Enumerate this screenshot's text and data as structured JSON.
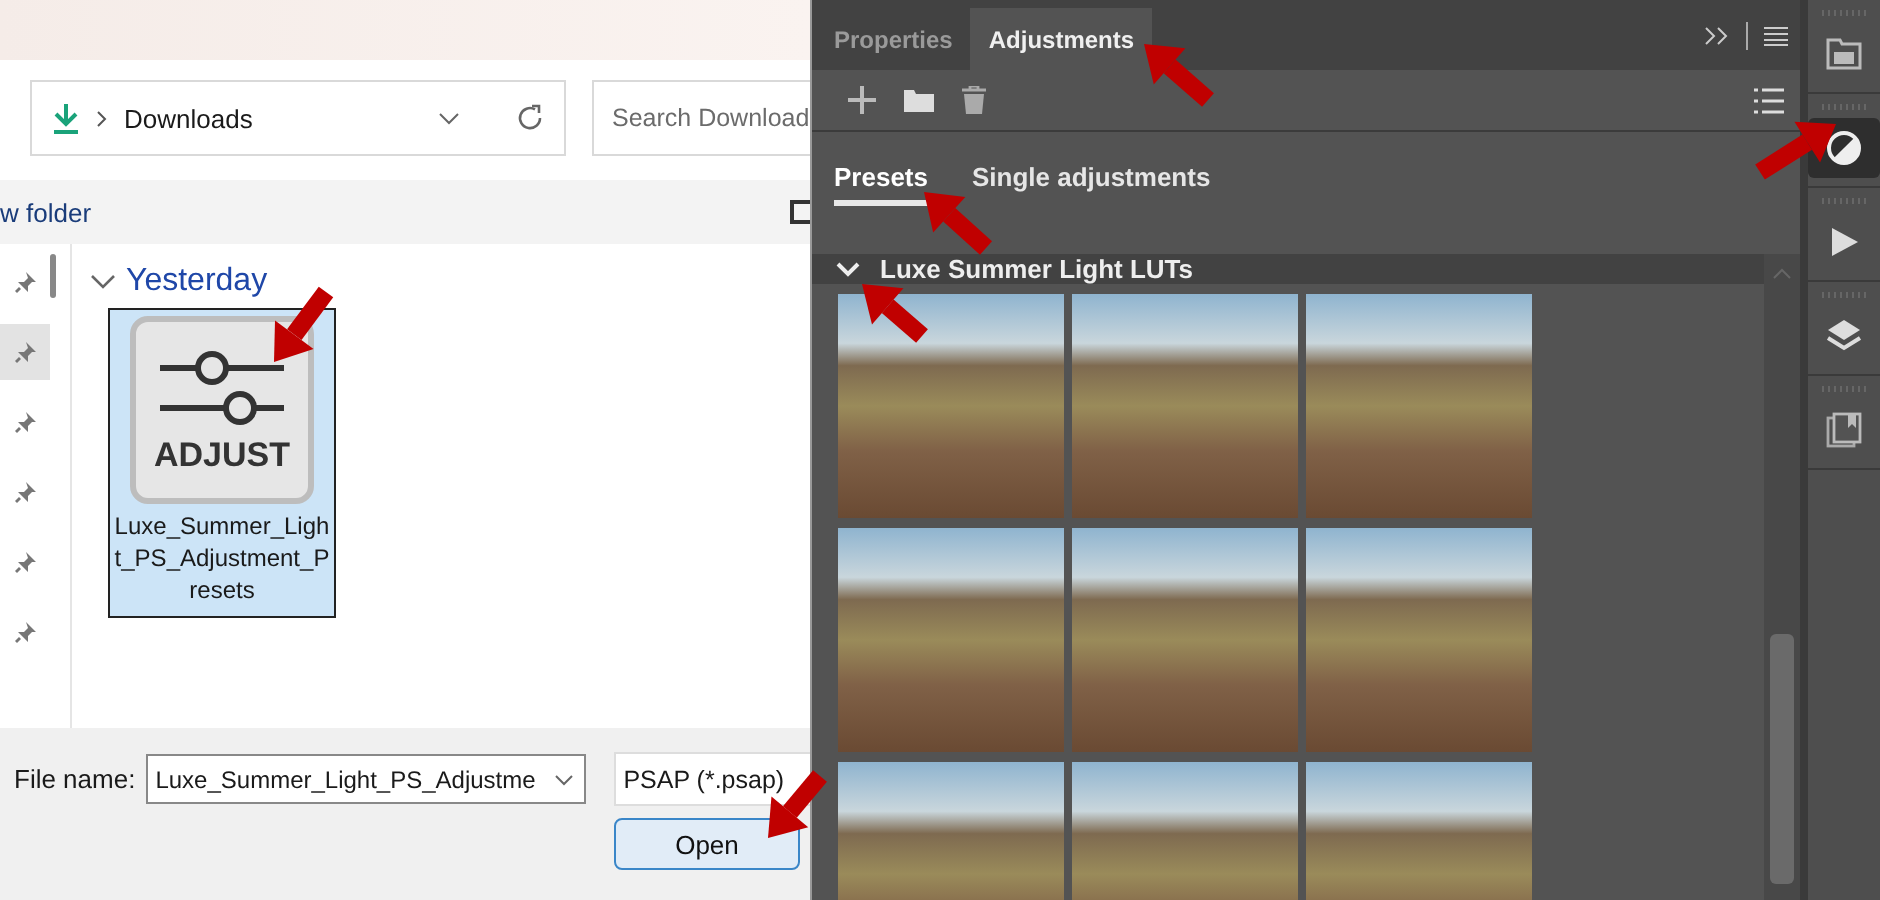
{
  "file_dialog": {
    "breadcrumb": "Downloads",
    "search": {
      "placeholder": "Search Download"
    },
    "toolbar": {
      "new_folder": "w folder"
    },
    "quick_access": [
      {
        "selected": false
      },
      {
        "selected": true
      },
      {
        "selected": false
      },
      {
        "selected": false
      },
      {
        "selected": false
      },
      {
        "selected": false
      }
    ],
    "group": {
      "label": "Yesterday",
      "expanded": true
    },
    "files": [
      {
        "name": "Luxe_Summer_Light_PS_Adjustment_Presets",
        "icon_label": "ADJUST",
        "selected": true
      }
    ],
    "file_name": {
      "label": "File name:",
      "value": "Luxe_Summer_Light_PS_Adjustme"
    },
    "file_type": "PSAP (*.psap)",
    "buttons": [
      "Open"
    ]
  },
  "panel": {
    "tabs": [
      {
        "label": "Properties",
        "selected": false
      },
      {
        "label": "Adjustments",
        "selected": true
      }
    ],
    "subtabs": [
      {
        "label": "Presets",
        "selected": true
      },
      {
        "label": "Single adjustments",
        "selected": false
      }
    ],
    "preset_group": {
      "label": "Luxe Summer Light LUTs",
      "expanded": true
    }
  },
  "dock": [
    {
      "kind": "libraries",
      "selected": false
    },
    {
      "kind": "adjustments",
      "selected": true
    },
    {
      "kind": "actions",
      "selected": false
    },
    {
      "kind": "layers",
      "selected": false
    },
    {
      "kind": "notes",
      "selected": false
    }
  ]
}
